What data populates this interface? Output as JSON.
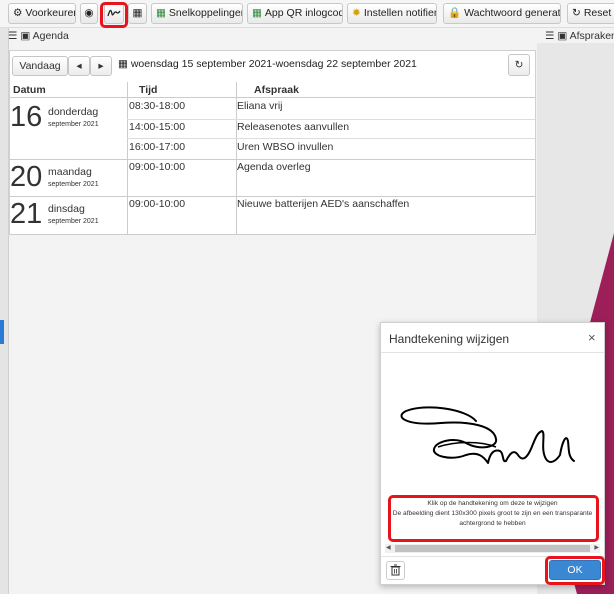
{
  "toolbar": {
    "voorkeuren": "Voorkeuren",
    "snelkoppelingen": "Snelkoppelingen",
    "app_qr": "App QR inlogcode",
    "notifier": "Instellen notifier",
    "wachtwoord": "Wachtwoord generator",
    "reset": "Reset l"
  },
  "panels": {
    "agenda_title": "Agenda",
    "afspraken_title": "Afspraken"
  },
  "agenda": {
    "today_label": "Vandaag",
    "prev_label": "◂",
    "next_label": "▸",
    "daterange": "woensdag 15 september 2021-woensdag 22 september 2021",
    "columns": {
      "datum": "Datum",
      "tijd": "Tijd",
      "afspraak": "Afspraak"
    },
    "days": [
      {
        "num": "16",
        "name": "donderdag",
        "month": "september 2021",
        "items": [
          {
            "time": "08:30-18:00",
            "text": "Eliana vrij"
          },
          {
            "time": "14:00-15:00",
            "text": "Releasenotes aanvullen"
          },
          {
            "time": "16:00-17:00",
            "text": "Uren WBSO invullen"
          }
        ]
      },
      {
        "num": "20",
        "name": "maandag",
        "month": "september 2021",
        "items": [
          {
            "time": "09:00-10:00",
            "text": "Agenda overleg"
          }
        ]
      },
      {
        "num": "21",
        "name": "dinsdag",
        "month": "september 2021",
        "items": [
          {
            "time": "09:00-10:00",
            "text": "Nieuwe batterijen AED's aanschaffen"
          }
        ]
      }
    ]
  },
  "modal": {
    "title": "Handtekening wijzigen",
    "close": "×",
    "info_line1": "Klik op de handtekening om deze te wijzigen",
    "info_line2": "De afbeelding dient 130x300 pixels groot te zijn en een transparante achtergrond te hebben",
    "ok_label": "OK"
  },
  "colors": {
    "accent": "#3a87d4",
    "highlight": "#e8141b",
    "background_purple": "#9c1f5a"
  }
}
